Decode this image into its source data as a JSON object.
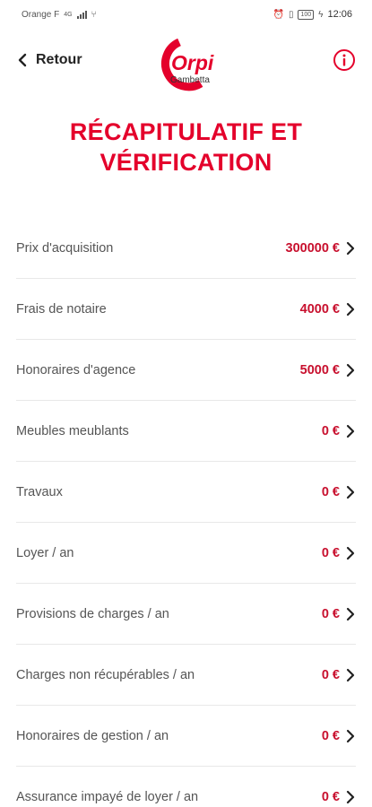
{
  "status_bar": {
    "carrier": "Orange F",
    "network": "4G",
    "battery": "100",
    "time": "12:06"
  },
  "header": {
    "back_label": "Retour",
    "logo_text": "Orpi",
    "logo_subtitle": "Gambetta"
  },
  "title": {
    "line1": "RÉCAPITULATIF ET",
    "line2": "VÉRIFICATION"
  },
  "rows": [
    {
      "label": "Prix d'acquisition",
      "value": "300000 €"
    },
    {
      "label": "Frais de notaire",
      "value": "4000 €"
    },
    {
      "label": "Honoraires d'agence",
      "value": "5000 €"
    },
    {
      "label": "Meubles meublants",
      "value": "0 €"
    },
    {
      "label": "Travaux",
      "value": "0 €"
    },
    {
      "label": "Loyer / an",
      "value": "0 €"
    },
    {
      "label": "Provisions de charges / an",
      "value": "0 €"
    },
    {
      "label": "Charges non récupérables / an",
      "value": "0 €"
    },
    {
      "label": "Honoraires de gestion / an",
      "value": "0 €"
    },
    {
      "label": "Assurance impayé de loyer / an",
      "value": "0 €"
    }
  ],
  "colors": {
    "accent": "#e4002b",
    "value": "#c8102e",
    "label": "#555555",
    "divider": "#e8e8e8"
  }
}
